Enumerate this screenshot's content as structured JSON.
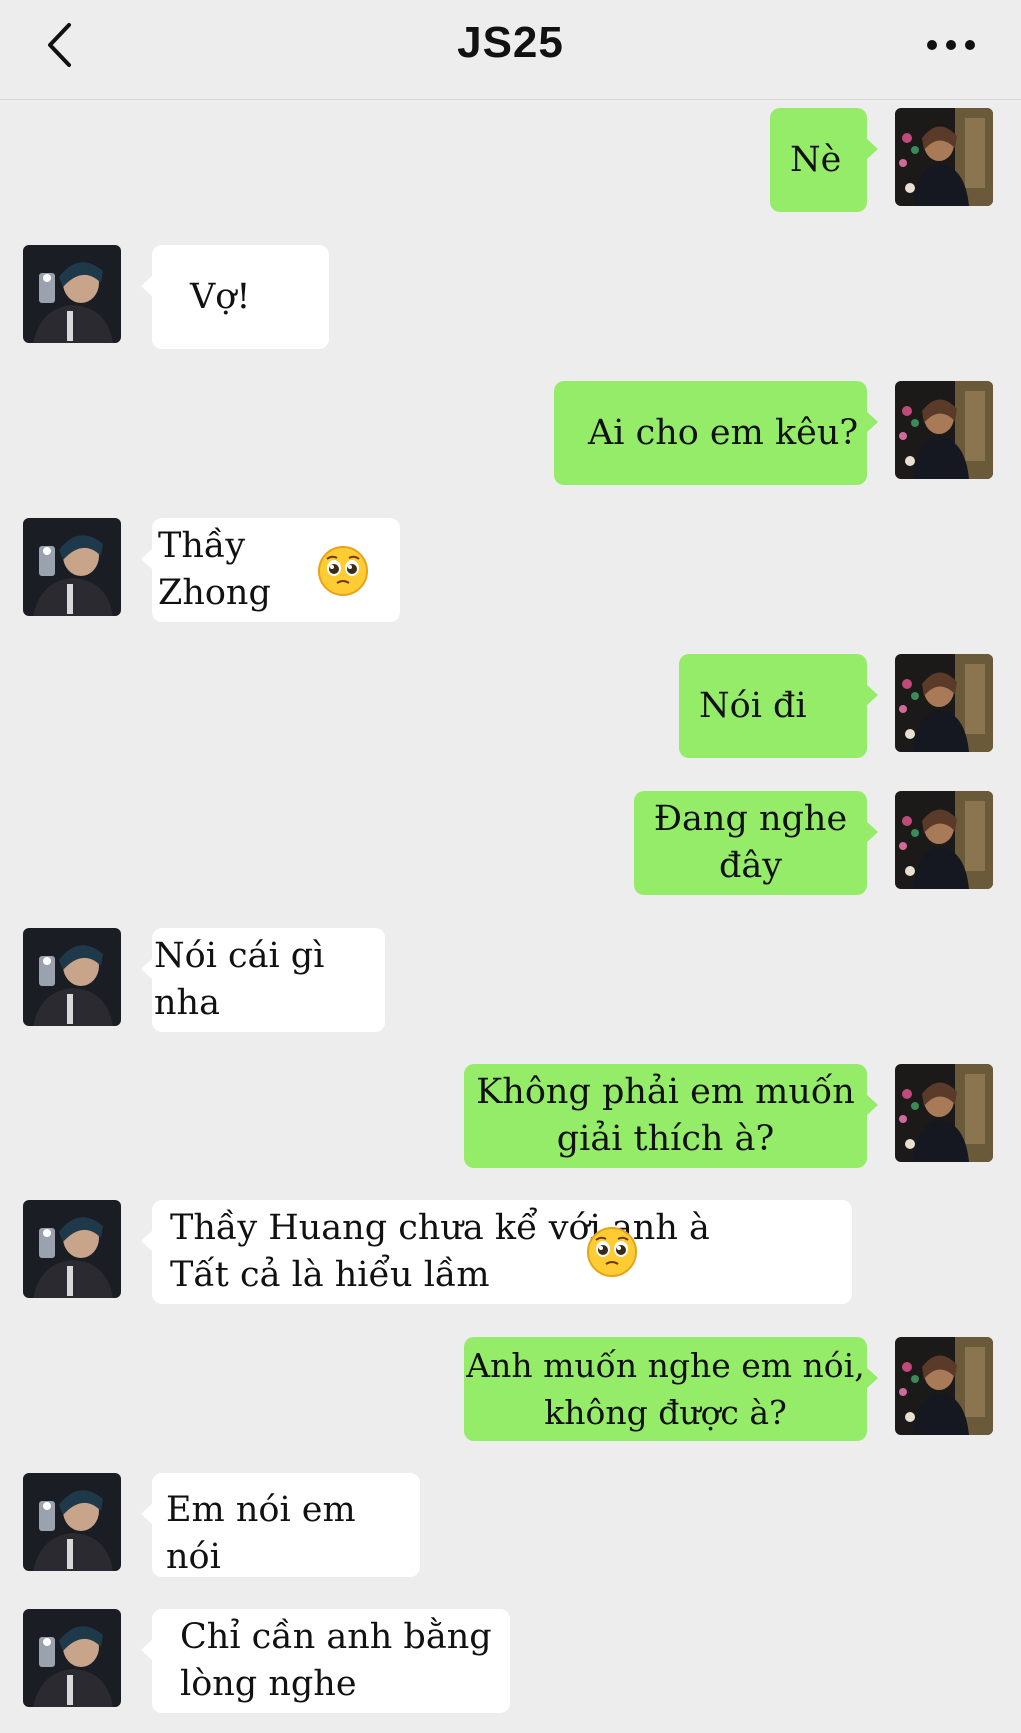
{
  "header": {
    "title": "JS25",
    "back_icon": "chevron-left-icon",
    "more_icon": "more-dots-icon"
  },
  "colors": {
    "background": "#ededed",
    "my_bubble": "#95ec69",
    "their_bubble": "#ffffff"
  },
  "messages": [
    {
      "sender": "me",
      "text": "Nè"
    },
    {
      "sender": "them",
      "text": "Vợ!"
    },
    {
      "sender": "me",
      "text": "Ai cho em kêu?"
    },
    {
      "sender": "them",
      "text": "Thầy\nZhong",
      "emoji": "pleading-face-emoji"
    },
    {
      "sender": "me",
      "text": "Nói đi"
    },
    {
      "sender": "me",
      "text": "Đang nghe\nđây"
    },
    {
      "sender": "them",
      "text": "Nói cái gì nha"
    },
    {
      "sender": "me",
      "text": "Không phải em muốn\ngiải thích à?"
    },
    {
      "sender": "them",
      "text": "Thầy Huang chưa kể với anh à\nTất cả là hiểu lầm",
      "emoji": "pleading-face-emoji"
    },
    {
      "sender": "me",
      "text": "Anh muốn nghe em nói,\nkhông được à?"
    },
    {
      "sender": "them",
      "text": "Em nói em nói"
    },
    {
      "sender": "them",
      "text": "Chỉ cần anh bằng\nlòng nghe"
    }
  ]
}
